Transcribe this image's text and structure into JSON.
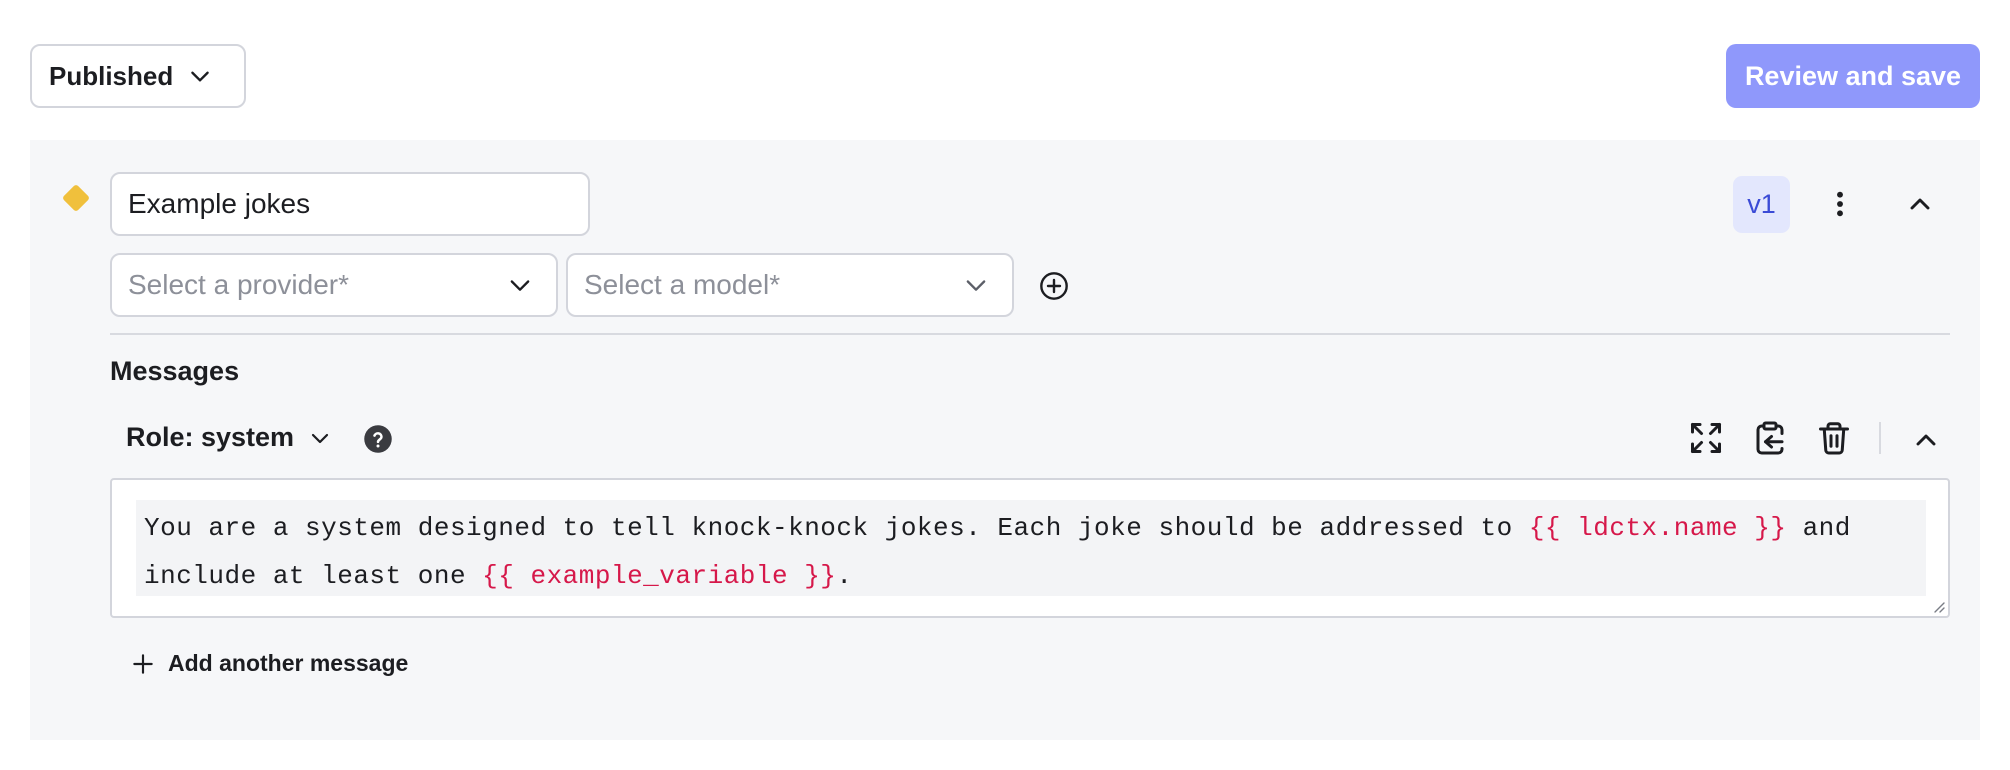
{
  "header": {
    "status_label": "Published",
    "review_button": "Review and save",
    "accent_color": "#8f98fb"
  },
  "variation": {
    "name_value": "Example jokes",
    "version_badge": "v1",
    "provider_placeholder": "Select a provider*",
    "model_placeholder": "Select a model*",
    "indicator_color": "#f0c03c"
  },
  "messages": {
    "title": "Messages",
    "items": [
      {
        "role_label": "Role: system",
        "text_parts": [
          "You are a system designed to tell knock-knock jokes. Each joke should be addressed to ",
          "{{ ldctx.name }}",
          " and include at least one ",
          "{{ example_variable }}",
          "."
        ],
        "variable_color": "#d6184a"
      }
    ],
    "add_label": "Add another message"
  },
  "icons": {
    "status_chevron": "chevron-down-icon",
    "add_model": "plus-circle-icon",
    "more": "kebab-icon",
    "collapse": "chevron-up-icon",
    "help": "question-circle-icon",
    "expand": "expand-icon",
    "paste": "clipboard-paste-icon",
    "delete": "trash-icon",
    "add": "plus-icon"
  }
}
